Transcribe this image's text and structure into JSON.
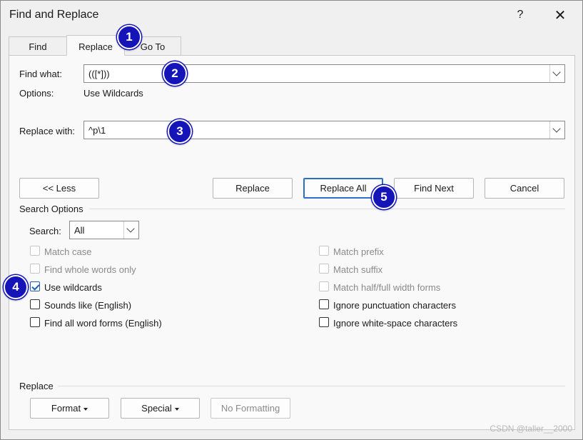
{
  "window": {
    "title": "Find and Replace",
    "help": "?",
    "close": "✕"
  },
  "tabs": [
    {
      "label": "Find"
    },
    {
      "label": "Replace"
    },
    {
      "label": "Go To"
    }
  ],
  "find": {
    "label": "Find what:",
    "value": "(([*]))",
    "options_label": "Options:",
    "options_value": "Use Wildcards"
  },
  "replace": {
    "label": "Replace with:",
    "value": "^p\\1"
  },
  "buttons": {
    "less": "<< Less",
    "replace": "Replace",
    "replace_all": "Replace All",
    "find_next": "Find Next",
    "cancel": "Cancel"
  },
  "search_options": {
    "title": "Search Options",
    "search_label": "Search:",
    "search_value": "All",
    "left": [
      {
        "label": "Match case",
        "checked": false,
        "disabled": true
      },
      {
        "label": "Find whole words only",
        "checked": false,
        "disabled": true
      },
      {
        "label": "Use wildcards",
        "checked": true,
        "disabled": false
      },
      {
        "label": "Sounds like (English)",
        "checked": false,
        "disabled": false
      },
      {
        "label": "Find all word forms (English)",
        "checked": false,
        "disabled": false
      }
    ],
    "right": [
      {
        "label": "Match prefix",
        "checked": false,
        "disabled": true
      },
      {
        "label": "Match suffix",
        "checked": false,
        "disabled": true
      },
      {
        "label": "Match half/full width forms",
        "checked": false,
        "disabled": true
      },
      {
        "label": "Ignore punctuation characters",
        "checked": false,
        "disabled": false
      },
      {
        "label": "Ignore white-space characters",
        "checked": false,
        "disabled": false
      }
    ]
  },
  "replace_section": {
    "title": "Replace",
    "format": "Format",
    "special": "Special",
    "no_formatting": "No Formatting"
  },
  "badges": [
    "1",
    "2",
    "3",
    "4",
    "5"
  ],
  "watermark": "CSDN @taller__2000",
  "colors": {
    "badge": "#1414b8",
    "check": "#1f5fbf",
    "default_button_border": "#2a6fc9"
  }
}
